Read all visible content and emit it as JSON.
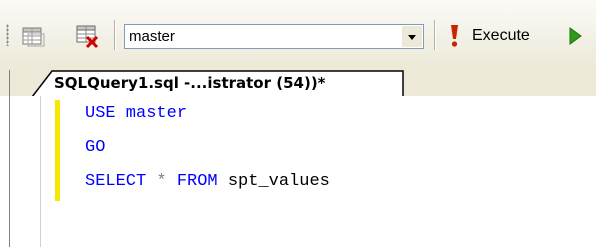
{
  "toolbar": {
    "database_value": "master",
    "execute_label": "Execute",
    "icons": [
      "query-options-icon",
      "grid-results-cancel-icon",
      "dropdown-arrow-icon",
      "execute-exclamation-icon",
      "debug-play-icon"
    ],
    "colors": {
      "execute_icon": "#cc2200",
      "play_icon": "#2e9b18"
    }
  },
  "tabs": [
    {
      "label": "SQLQuery1.sql -...istrator (54))*",
      "active": true
    }
  ],
  "editor": {
    "line1": {
      "kw": "USE",
      "rest": " master"
    },
    "line2": {
      "kw": "GO"
    },
    "line3": {
      "kw1": "SELECT",
      "op": " * ",
      "kw2": "FROM",
      "rest": " spt_values"
    },
    "colors": {
      "keyword": "#0000ff",
      "operator": "#808080",
      "identifier": "#000000",
      "changed_lines_bar": "#f7e600"
    }
  }
}
